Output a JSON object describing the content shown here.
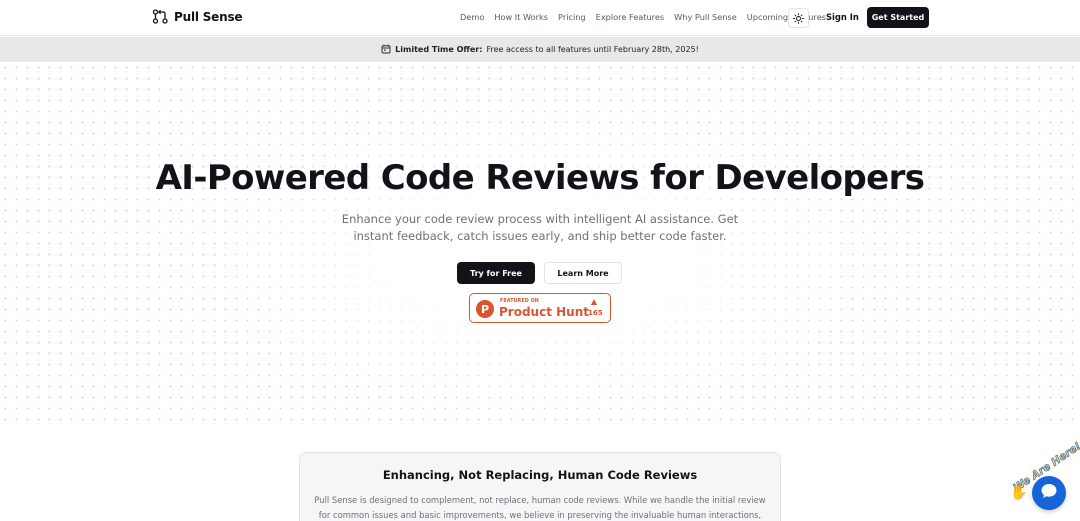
{
  "header": {
    "brand_name": "Pull Sense",
    "brand_icon": "git-pull-request-icon",
    "nav": [
      "Demo",
      "How It Works",
      "Pricing",
      "Explore Features",
      "Why Pull Sense",
      "Upcoming Features"
    ],
    "theme_toggle_icon": "sun-icon",
    "sign_in": "Sign In",
    "get_started": "Get Started"
  },
  "banner": {
    "icon": "calendar-icon",
    "label": "Limited Time Offer:",
    "text": "Free access to all features until February 28th, 2025!"
  },
  "hero": {
    "title": "AI-Powered Code Reviews for  Developers",
    "subtitle": "Enhance your code review process with intelligent AI assistance. Get instant feedback, catch issues early, and ship better code faster.",
    "primary_button": "Try for Free",
    "secondary_button": "Learn More",
    "product_hunt": {
      "logo_letter": "P",
      "featured_on": "FEATURED ON",
      "name": "Product Hunt",
      "upvotes": "165",
      "color": "#da552f"
    }
  },
  "card": {
    "title": "Enhancing, Not Replacing, Human Code Reviews",
    "body": "Pull Sense is designed to complement, not replace, human code reviews. While we handle the initial review for common issues and basic improvements, we believe in preserving the invaluable human interactions, mentorship"
  },
  "chat": {
    "label": "We Are Here!",
    "icon": "chat-bubble-icon",
    "color": "#1565d8"
  },
  "colors": {
    "primary": "#111318",
    "muted_text": "#6b7079",
    "banner_bg": "#e8e8ea"
  }
}
